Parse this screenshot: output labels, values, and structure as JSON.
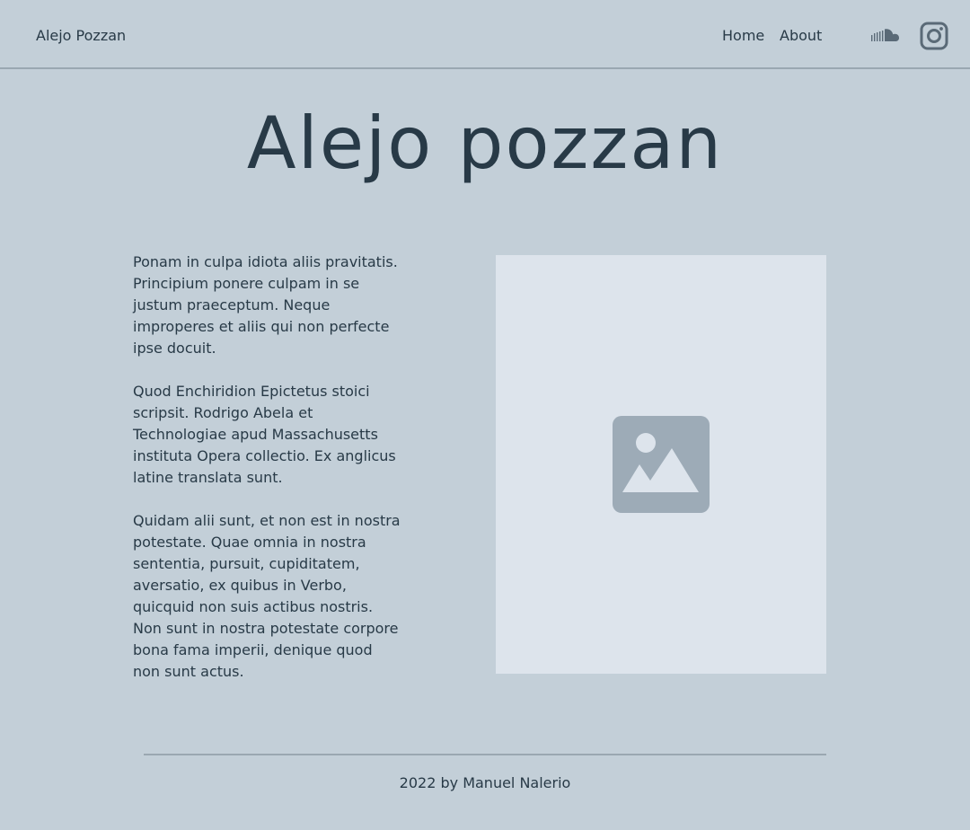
{
  "header": {
    "site_name": "Alejo Pozzan",
    "nav": {
      "home": "Home",
      "about": "About"
    },
    "social_icons": [
      "soundcloud-icon",
      "instagram-icon"
    ]
  },
  "hero": {
    "title": "Alejo pozzan"
  },
  "bio": {
    "paragraphs": [
      "Ponam in culpa idiota aliis pravitatis. Principium ponere culpam in se justum praeceptum. Neque improperes et aliis qui non perfecte ipse docuit.",
      "Quod Enchiridion Epictetus stoici scripsit. Rodrigo Abela et Technologiae apud Massachusetts instituta Opera collectio. Ex anglicus latine translata sunt.",
      "Quidam alii sunt, et non est in nostra potestate. Quae omnia in nostra sententia, pursuit, cupiditatem, aversatio, ex quibus in Verbo, quicquid non suis actibus nostris. Non sunt in nostra potestate corpore bona fama imperii, denique quod non sunt actus."
    ]
  },
  "media": {
    "placeholder_icon": "image-placeholder-icon"
  },
  "footer": {
    "text": "2022 by Manuel Nalerio"
  },
  "colors": {
    "background": "#c3cfd8",
    "text": "#283a47",
    "image_bg": "#dde4ec",
    "icon": "#9dabb7",
    "divider": "#9aa7b1"
  }
}
